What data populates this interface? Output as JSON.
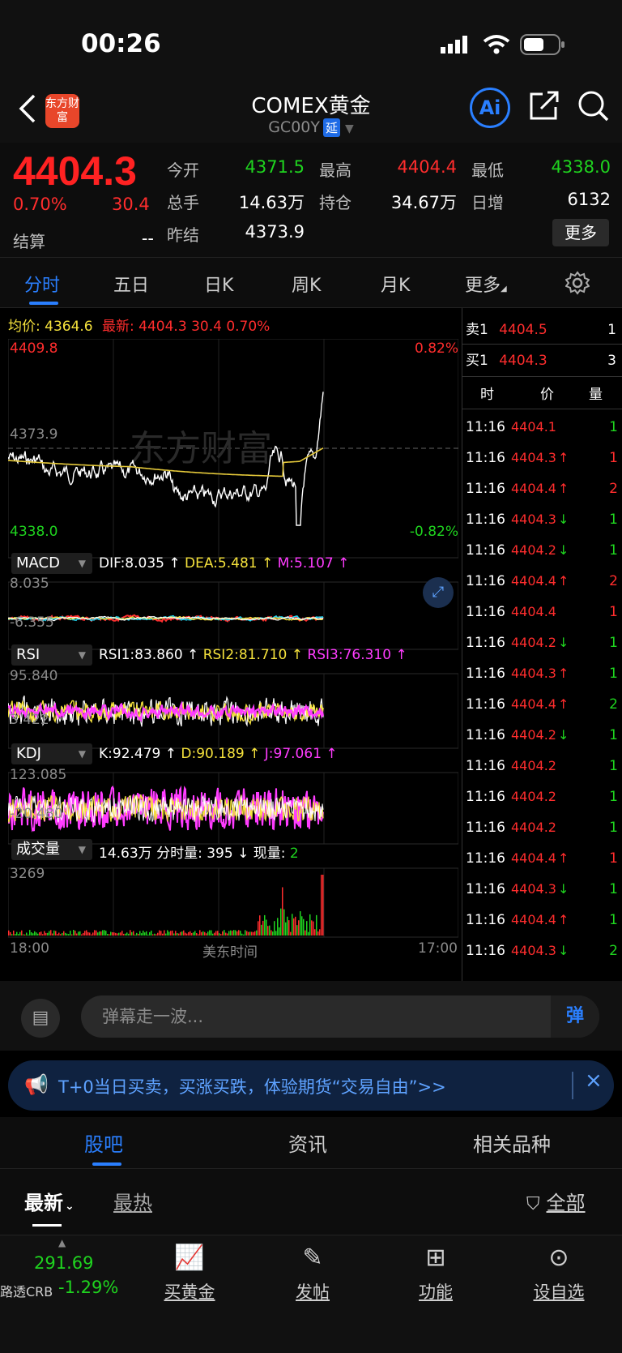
{
  "status": {
    "time": "00:26"
  },
  "nav": {
    "title": "COMEX黄金",
    "code": "GC00Y",
    "delay_tag": "延",
    "logo_text": "东方财富",
    "ai_label": "Ai"
  },
  "quote": {
    "price": "4404.3",
    "change_pct": "0.70%",
    "change": "30.4",
    "settle_label": "结算",
    "settle_value": "--",
    "fields": [
      {
        "label": "今开",
        "value": "4371.5",
        "color": "#1fd41f"
      },
      {
        "label": "最高",
        "value": "4404.4",
        "color": "#ff2d2d"
      },
      {
        "label": "最低",
        "value": "4338.0",
        "color": "#1fd41f"
      },
      {
        "label": "总手",
        "value": "14.63万",
        "color": "#ffffff"
      },
      {
        "label": "持仓",
        "value": "34.67万",
        "color": "#ffffff"
      },
      {
        "label": "日增",
        "value": "6132",
        "color": "#ffffff"
      },
      {
        "label": "昨结",
        "value": "4373.9",
        "color": "#ffffff"
      }
    ],
    "more_label": "更多"
  },
  "tabs": [
    "分时",
    "五日",
    "日K",
    "周K",
    "月K",
    "更多"
  ],
  "chart": {
    "avg_label": "均价:",
    "avg_value": "4364.6",
    "latest_label": "最新:",
    "latest_value": "4404.3",
    "latest_change": "30.4",
    "latest_pct": "0.70%",
    "y_high": "4409.8",
    "y_low": "4338.0",
    "y_mid": "4373.9",
    "pct_high": "0.82%",
    "pct_low": "-0.82%",
    "watermark": "东方财富",
    "x_start": "18:00",
    "x_mid": "美东时间",
    "x_end": "17:00",
    "macd": {
      "name": "MACD",
      "dif": "DIF:8.035 ↑",
      "dea": "DEA:5.481 ↑",
      "m": "M:5.107 ↑",
      "top": "8.035",
      "bottom": "-6.355"
    },
    "rsi": {
      "name": "RSI",
      "rsi1": "RSI1:83.860 ↑",
      "rsi2": "RSI2:81.710 ↑",
      "rsi3": "RSI3:76.310 ↑",
      "top": "95.840",
      "bottom": "3.422"
    },
    "kdj": {
      "name": "KDJ",
      "k": "K:92.479 ↑",
      "d": "D:90.189 ↑",
      "j": "J:97.061 ↑",
      "top": "123.085",
      "bottom": "-20.480"
    },
    "vol": {
      "name": "成交量",
      "total": "14.63万",
      "fs_label": "分时量:",
      "fs_value": "395 ↓",
      "now_label": "现量:",
      "now_value": "2",
      "top": "3269"
    }
  },
  "order_book": {
    "sell_label": "卖1",
    "sell_price": "4404.5",
    "sell_qty": "1",
    "buy_label": "买1",
    "buy_price": "4404.3",
    "buy_qty": "3",
    "headers": [
      "时",
      "价",
      "量"
    ],
    "ticks": [
      {
        "t": "11:16",
        "p": "4404.1",
        "a": "",
        "q": "1",
        "qc": "green"
      },
      {
        "t": "11:16",
        "p": "4404.3",
        "a": "↑",
        "q": "1",
        "qc": "red"
      },
      {
        "t": "11:16",
        "p": "4404.4",
        "a": "↑",
        "q": "2",
        "qc": "red"
      },
      {
        "t": "11:16",
        "p": "4404.3",
        "a": "↓",
        "q": "1",
        "qc": "green"
      },
      {
        "t": "11:16",
        "p": "4404.2",
        "a": "↓",
        "q": "1",
        "qc": "green"
      },
      {
        "t": "11:16",
        "p": "4404.4",
        "a": "↑",
        "q": "2",
        "qc": "red"
      },
      {
        "t": "11:16",
        "p": "4404.4",
        "a": "",
        "q": "1",
        "qc": "red"
      },
      {
        "t": "11:16",
        "p": "4404.2",
        "a": "↓",
        "q": "1",
        "qc": "green"
      },
      {
        "t": "11:16",
        "p": "4404.3",
        "a": "↑",
        "q": "1",
        "qc": "green"
      },
      {
        "t": "11:16",
        "p": "4404.4",
        "a": "↑",
        "q": "2",
        "qc": "green"
      },
      {
        "t": "11:16",
        "p": "4404.2",
        "a": "↓",
        "q": "1",
        "qc": "green"
      },
      {
        "t": "11:16",
        "p": "4404.2",
        "a": "",
        "q": "1",
        "qc": "green"
      },
      {
        "t": "11:16",
        "p": "4404.2",
        "a": "",
        "q": "1",
        "qc": "green"
      },
      {
        "t": "11:16",
        "p": "4404.2",
        "a": "",
        "q": "1",
        "qc": "green"
      },
      {
        "t": "11:16",
        "p": "4404.4",
        "a": "↑",
        "q": "1",
        "qc": "red"
      },
      {
        "t": "11:16",
        "p": "4404.3",
        "a": "↓",
        "q": "1",
        "qc": "green"
      },
      {
        "t": "11:16",
        "p": "4404.4",
        "a": "↑",
        "q": "1",
        "qc": "green"
      },
      {
        "t": "11:16",
        "p": "4404.3",
        "a": "↓",
        "q": "2",
        "qc": "green"
      }
    ]
  },
  "comment": {
    "placeholder": "弹幕走一波...",
    "danmu_label": "弹"
  },
  "ad": {
    "text": "T+0当日买卖，买涨买跌，体验期货“交易自由”>>"
  },
  "sections": {
    "tabs": [
      "股吧",
      "资讯",
      "相关品种"
    ],
    "sort_latest": "最新",
    "sort_hot": "最热",
    "filter_all": "全部"
  },
  "bottom": {
    "index_value": "291.69",
    "index_name": "路透CRB",
    "index_pct": "-1.29%",
    "actions": [
      "买黄金",
      "发帖",
      "功能",
      "设自选"
    ]
  }
}
